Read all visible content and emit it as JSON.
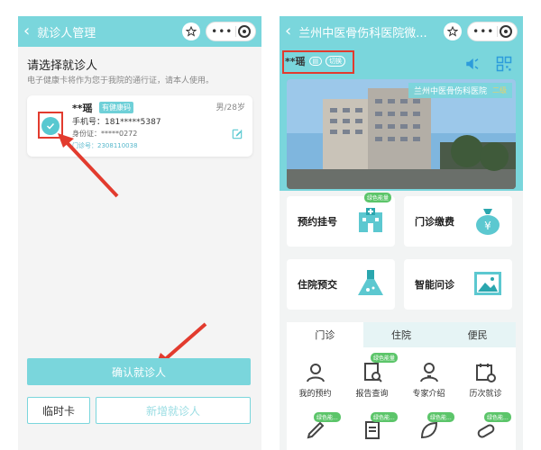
{
  "left": {
    "nav_title": "就诊人管理",
    "select_title": "请选择就诊人",
    "select_sub": "电子健康卡将作为您于我院的通行证，请本人使用。",
    "card": {
      "name": "**瑶",
      "badge": "有健康码",
      "gender_age": "男/28岁",
      "phone": "手机号：181*****5387",
      "id": "身份证：*****0272",
      "mz": "门诊号：2308110038"
    },
    "confirm_label": "确认就诊人",
    "temp_label": "临时卡",
    "add_label": "新增就诊人"
  },
  "right": {
    "nav_title": "兰州中医骨伤科医院微...",
    "patient_name": "**瑶",
    "switch_label": "切换",
    "banner_title": "兰州中医骨伤科医院",
    "banner_tag": "二级",
    "tiles": [
      {
        "label": "预约挂号",
        "badge": "绿色能量"
      },
      {
        "label": "门诊缴费"
      },
      {
        "label": "住院预交"
      },
      {
        "label": "智能问诊"
      }
    ],
    "tabs": [
      "门诊",
      "住院",
      "便民"
    ],
    "grid": [
      {
        "label": "我的预约"
      },
      {
        "label": "报告查询",
        "badge": "绿色能量"
      },
      {
        "label": "专家介绍"
      },
      {
        "label": "历次就诊"
      }
    ],
    "grid_badges_row2": [
      "绿色能...",
      "绿色能...",
      "绿色能...",
      "绿色能..."
    ]
  },
  "colors": {
    "accent": "#7ad6dc",
    "highlight": "#e23b2e",
    "green": "#5cc56a"
  }
}
